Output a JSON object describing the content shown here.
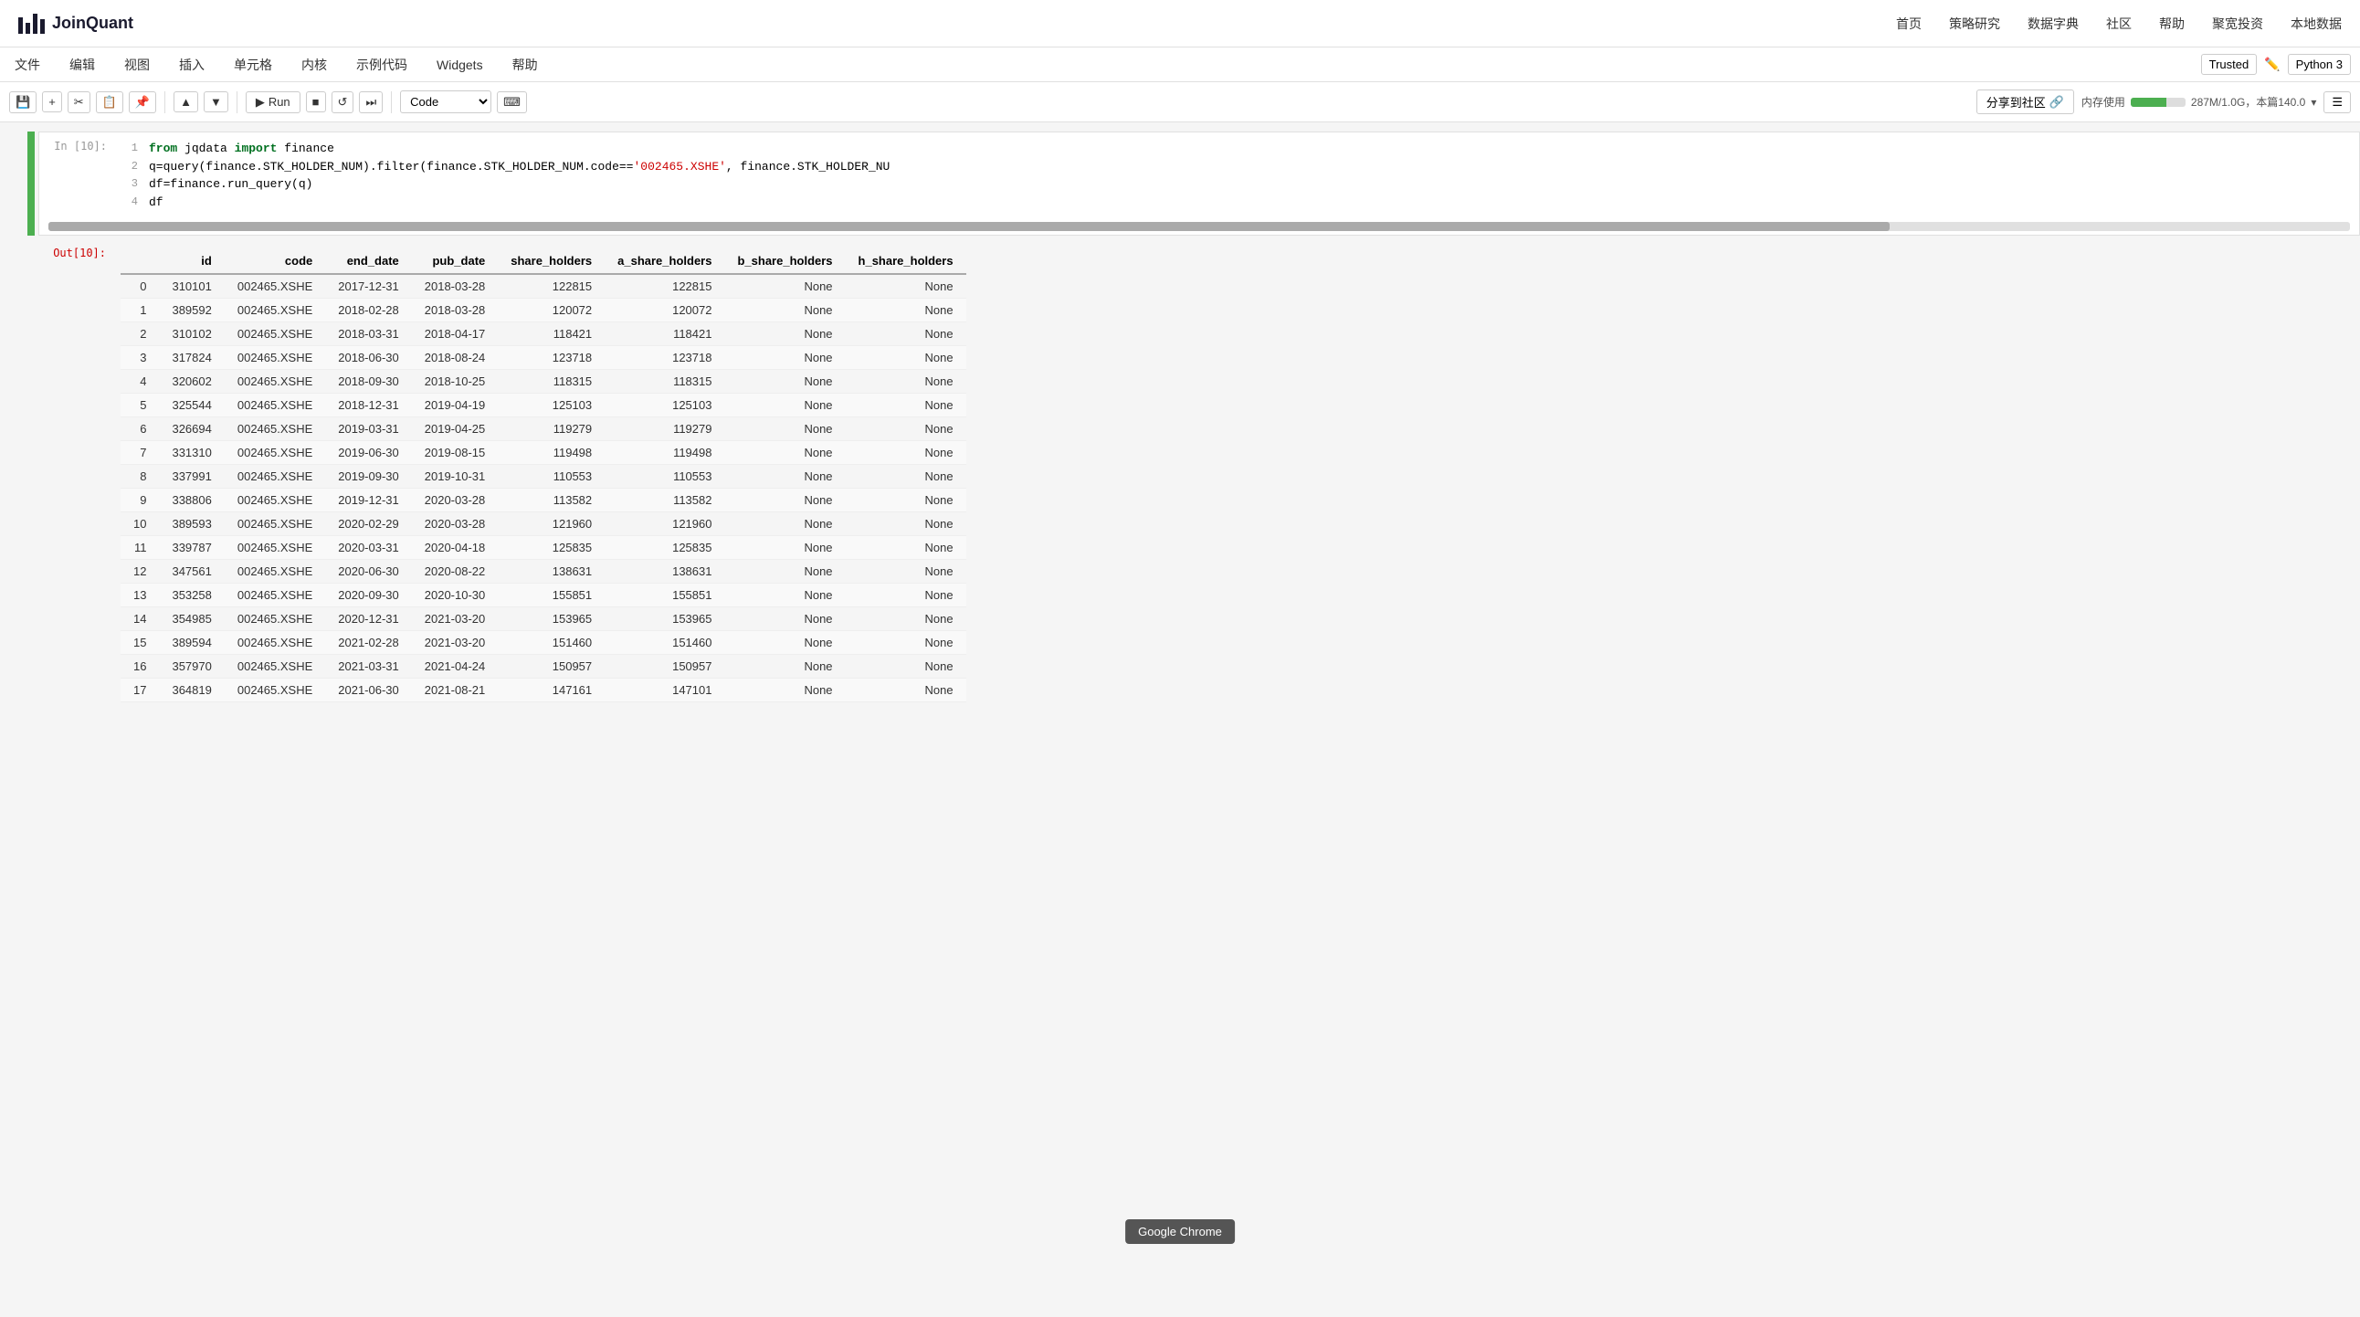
{
  "brand": {
    "name": "JoinQuant"
  },
  "top_nav": {
    "items": [
      {
        "label": "首页"
      },
      {
        "label": "策略研究"
      },
      {
        "label": "数据字典"
      },
      {
        "label": "社区"
      },
      {
        "label": "帮助"
      },
      {
        "label": "聚宽投资"
      },
      {
        "label": "本地数据"
      }
    ]
  },
  "notebook_menu": {
    "items": [
      {
        "label": "文件"
      },
      {
        "label": "编辑"
      },
      {
        "label": "视图"
      },
      {
        "label": "插入"
      },
      {
        "label": "单元格"
      },
      {
        "label": "内核"
      },
      {
        "label": "示例代码"
      },
      {
        "label": "Widgets"
      },
      {
        "label": "帮助"
      }
    ]
  },
  "toolbar": {
    "run_label": "Run",
    "code_option": "Code",
    "share_label": "分享到社区",
    "memory_label": "内存使用",
    "memory_value": "287M/1.0G，本篇140.0",
    "trusted_label": "Trusted",
    "python_label": "Python 3"
  },
  "cell": {
    "input_number": "In [10]:",
    "output_number": "Out[10]:",
    "code_lines": [
      {
        "num": "1",
        "text": "from jqdata import finance"
      },
      {
        "num": "2",
        "text": "q=query(finance.STK_HOLDER_NUM).filter(finance.STK_HOLDER_NUM.code=="
      },
      {
        "num": "3",
        "text": "df=finance.run_query(q)"
      },
      {
        "num": "4",
        "text": "df"
      }
    ],
    "string_value": "'002465.XSHE'",
    "code_suffix": ", finance.STK_HOLDER_NU"
  },
  "table": {
    "columns": [
      "id",
      "code",
      "end_date",
      "pub_date",
      "share_holders",
      "a_share_holders",
      "b_share_holders",
      "h_share_holders"
    ],
    "rows": [
      {
        "idx": "0",
        "id": "310101",
        "code": "002465.XSHE",
        "end_date": "2017-12-31",
        "pub_date": "2018-03-28",
        "share_holders": "122815",
        "a_share_holders": "122815",
        "b_share_holders": "None",
        "h_share_holders": "None"
      },
      {
        "idx": "1",
        "id": "389592",
        "code": "002465.XSHE",
        "end_date": "2018-02-28",
        "pub_date": "2018-03-28",
        "share_holders": "120072",
        "a_share_holders": "120072",
        "b_share_holders": "None",
        "h_share_holders": "None"
      },
      {
        "idx": "2",
        "id": "310102",
        "code": "002465.XSHE",
        "end_date": "2018-03-31",
        "pub_date": "2018-04-17",
        "share_holders": "118421",
        "a_share_holders": "118421",
        "b_share_holders": "None",
        "h_share_holders": "None"
      },
      {
        "idx": "3",
        "id": "317824",
        "code": "002465.XSHE",
        "end_date": "2018-06-30",
        "pub_date": "2018-08-24",
        "share_holders": "123718",
        "a_share_holders": "123718",
        "b_share_holders": "None",
        "h_share_holders": "None"
      },
      {
        "idx": "4",
        "id": "320602",
        "code": "002465.XSHE",
        "end_date": "2018-09-30",
        "pub_date": "2018-10-25",
        "share_holders": "118315",
        "a_share_holders": "118315",
        "b_share_holders": "None",
        "h_share_holders": "None"
      },
      {
        "idx": "5",
        "id": "325544",
        "code": "002465.XSHE",
        "end_date": "2018-12-31",
        "pub_date": "2019-04-19",
        "share_holders": "125103",
        "a_share_holders": "125103",
        "b_share_holders": "None",
        "h_share_holders": "None"
      },
      {
        "idx": "6",
        "id": "326694",
        "code": "002465.XSHE",
        "end_date": "2019-03-31",
        "pub_date": "2019-04-25",
        "share_holders": "119279",
        "a_share_holders": "119279",
        "b_share_holders": "None",
        "h_share_holders": "None"
      },
      {
        "idx": "7",
        "id": "331310",
        "code": "002465.XSHE",
        "end_date": "2019-06-30",
        "pub_date": "2019-08-15",
        "share_holders": "119498",
        "a_share_holders": "119498",
        "b_share_holders": "None",
        "h_share_holders": "None"
      },
      {
        "idx": "8",
        "id": "337991",
        "code": "002465.XSHE",
        "end_date": "2019-09-30",
        "pub_date": "2019-10-31",
        "share_holders": "110553",
        "a_share_holders": "110553",
        "b_share_holders": "None",
        "h_share_holders": "None"
      },
      {
        "idx": "9",
        "id": "338806",
        "code": "002465.XSHE",
        "end_date": "2019-12-31",
        "pub_date": "2020-03-28",
        "share_holders": "113582",
        "a_share_holders": "113582",
        "b_share_holders": "None",
        "h_share_holders": "None"
      },
      {
        "idx": "10",
        "id": "389593",
        "code": "002465.XSHE",
        "end_date": "2020-02-29",
        "pub_date": "2020-03-28",
        "share_holders": "121960",
        "a_share_holders": "121960",
        "b_share_holders": "None",
        "h_share_holders": "None"
      },
      {
        "idx": "11",
        "id": "339787",
        "code": "002465.XSHE",
        "end_date": "2020-03-31",
        "pub_date": "2020-04-18",
        "share_holders": "125835",
        "a_share_holders": "125835",
        "b_share_holders": "None",
        "h_share_holders": "None"
      },
      {
        "idx": "12",
        "id": "347561",
        "code": "002465.XSHE",
        "end_date": "2020-06-30",
        "pub_date": "2020-08-22",
        "share_holders": "138631",
        "a_share_holders": "138631",
        "b_share_holders": "None",
        "h_share_holders": "None"
      },
      {
        "idx": "13",
        "id": "353258",
        "code": "002465.XSHE",
        "end_date": "2020-09-30",
        "pub_date": "2020-10-30",
        "share_holders": "155851",
        "a_share_holders": "155851",
        "b_share_holders": "None",
        "h_share_holders": "None"
      },
      {
        "idx": "14",
        "id": "354985",
        "code": "002465.XSHE",
        "end_date": "2020-12-31",
        "pub_date": "2021-03-20",
        "share_holders": "153965",
        "a_share_holders": "153965",
        "b_share_holders": "None",
        "h_share_holders": "None"
      },
      {
        "idx": "15",
        "id": "389594",
        "code": "002465.XSHE",
        "end_date": "2021-02-28",
        "pub_date": "2021-03-20",
        "share_holders": "151460",
        "a_share_holders": "151460",
        "b_share_holders": "None",
        "h_share_holders": "None"
      },
      {
        "idx": "16",
        "id": "357970",
        "code": "002465.XSHE",
        "end_date": "2021-03-31",
        "pub_date": "2021-04-24",
        "share_holders": "150957",
        "a_share_holders": "150957",
        "b_share_holders": "None",
        "h_share_holders": "None"
      },
      {
        "idx": "17",
        "id": "364819",
        "code": "002465.XSHE",
        "end_date": "2021-06-30",
        "pub_date": "2021-08-21",
        "share_holders": "147161",
        "a_share_holders": "147101",
        "b_share_holders": "None",
        "h_share_holders": "None"
      }
    ]
  },
  "tooltip": {
    "text": "Google Chrome"
  }
}
